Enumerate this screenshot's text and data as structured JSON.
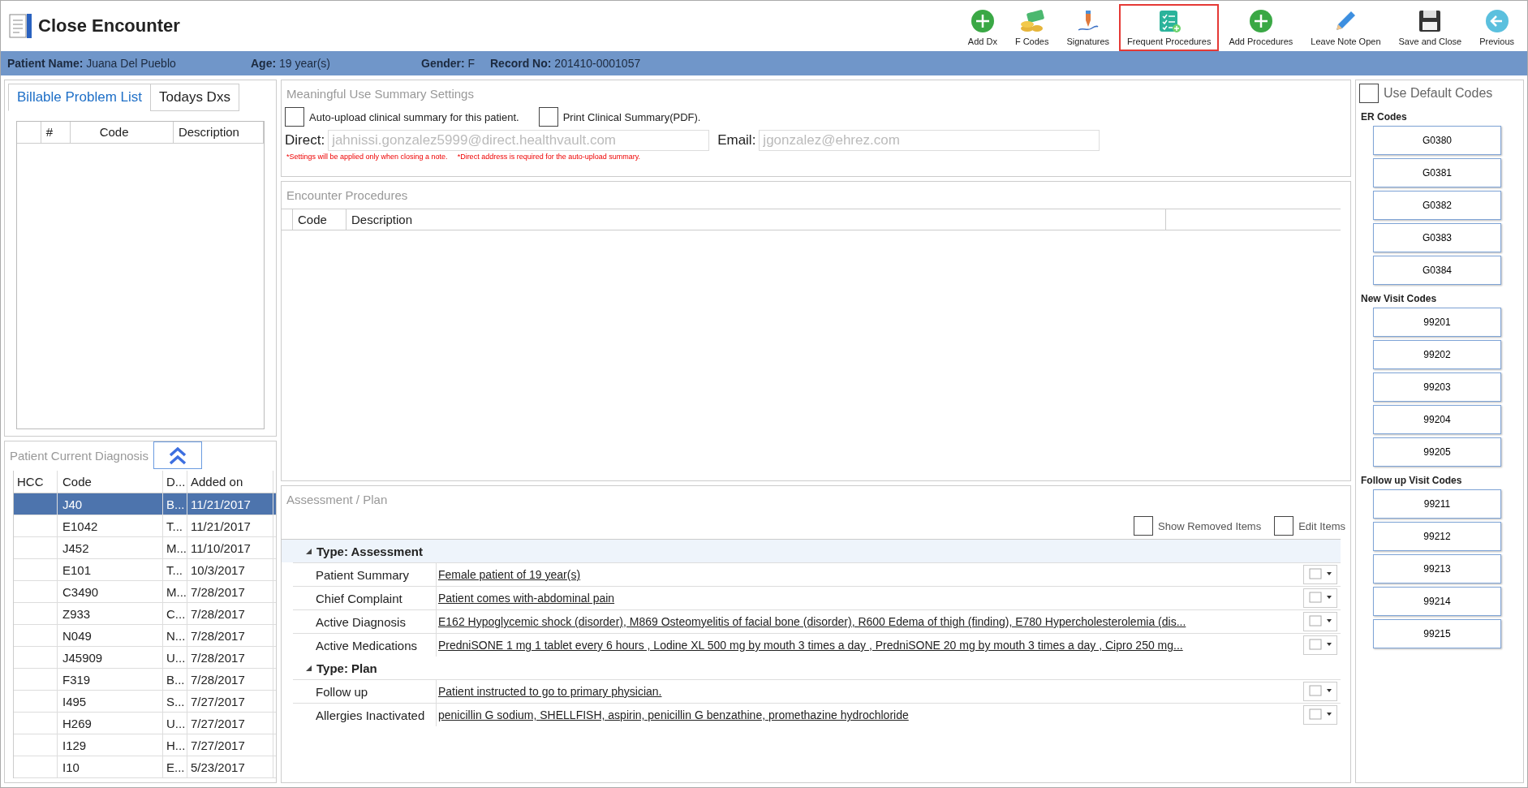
{
  "window": {
    "title": "Close Encounter"
  },
  "toolbar": [
    {
      "label": "Add Dx",
      "selected": false
    },
    {
      "label": "F Codes",
      "selected": false
    },
    {
      "label": "Signatures",
      "selected": false
    },
    {
      "label": "Frequent Procedures",
      "selected": true
    },
    {
      "label": "Add Procedures",
      "selected": false
    },
    {
      "label": "Leave Note Open",
      "selected": false
    },
    {
      "label": "Save and Close",
      "selected": false
    },
    {
      "label": "Previous",
      "selected": false
    }
  ],
  "patient_bar": [
    {
      "label": "Patient Name:",
      "value": "Juana Del Pueblo"
    },
    {
      "label": "Age:",
      "value": "19 year(s)"
    },
    {
      "label": "Gender:",
      "value": "F"
    },
    {
      "label": "Record No:",
      "value": "201410-0001057"
    }
  ],
  "tabs": [
    {
      "label": "Billable Problem List",
      "selected": true
    },
    {
      "label": "Todays Dxs",
      "selected": false
    }
  ],
  "problem_list": {
    "columns": [
      "#",
      "Code",
      "Description"
    ]
  },
  "current_diagnosis": {
    "title": "Patient Current Diagnosis",
    "columns": [
      "HCC",
      "Code",
      "D...",
      "Added on"
    ],
    "rows": [
      {
        "code": "J40",
        "d": "B...",
        "added_on": "11/21/2017",
        "selected": true
      },
      {
        "code": "E1042",
        "d": "T...",
        "added_on": "11/21/2017",
        "selected": false
      },
      {
        "code": "J452",
        "d": "M...",
        "added_on": "11/10/2017",
        "selected": false
      },
      {
        "code": "E101",
        "d": "T...",
        "added_on": "10/3/2017",
        "selected": false
      },
      {
        "code": "C3490",
        "d": "M...",
        "added_on": "7/28/2017",
        "selected": false
      },
      {
        "code": "Z933",
        "d": "C...",
        "added_on": "7/28/2017",
        "selected": false
      },
      {
        "code": "N049",
        "d": "N...",
        "added_on": "7/28/2017",
        "selected": false
      },
      {
        "code": "J45909",
        "d": "U...",
        "added_on": "7/28/2017",
        "selected": false
      },
      {
        "code": "F319",
        "d": "B...",
        "added_on": "7/28/2017",
        "selected": false
      },
      {
        "code": "I495",
        "d": "S...",
        "added_on": "7/27/2017",
        "selected": false
      },
      {
        "code": "H269",
        "d": "U...",
        "added_on": "7/27/2017",
        "selected": false
      },
      {
        "code": "I129",
        "d": "H...",
        "added_on": "7/27/2017",
        "selected": false
      },
      {
        "code": "I10",
        "d": "E...",
        "added_on": "5/23/2017",
        "selected": false
      }
    ]
  },
  "meaningful_use": {
    "title": "Meaningful Use Summary Settings",
    "checkboxes": [
      {
        "label": "Auto-upload clinical summary for this patient.",
        "checked": false
      },
      {
        "label": "Print Clinical Summary(PDF).",
        "checked": false
      }
    ],
    "direct": {
      "label": "Direct:",
      "placeholder": "jahnissi.gonzalez5999@direct.healthvault.com"
    },
    "email": {
      "label": "Email:",
      "placeholder": "jgonzalez@ehrez.com"
    },
    "notes": [
      "*Settings will be applied only when closing a note.",
      "*Direct address is required for the auto-upload summary."
    ]
  },
  "encounter_procedures": {
    "title": "Encounter Procedures",
    "columns": [
      "Code",
      "Description"
    ]
  },
  "assessment_plan": {
    "title": "Assessment / Plan",
    "options": [
      {
        "label": "Show Removed Items",
        "checked": false
      },
      {
        "label": "Edit Items",
        "checked": false
      }
    ],
    "groups": [
      {
        "type": "Type: Assessment",
        "expanded": true,
        "rows": [
          {
            "label": "Patient Summary",
            "value": "Female patient of 19 year(s)"
          },
          {
            "label": "Chief Complaint",
            "value": "Patient comes with-abdominal pain"
          },
          {
            "label": "Active Diagnosis",
            "value": "E162 Hypoglycemic shock (disorder), M869 Osteomyelitis of facial bone (disorder), R600 Edema of thigh (finding), E780 Hypercholesterolemia (dis..."
          },
          {
            "label": "Active Medications",
            "value": "PredniSONE 1 mg 1 tablet every 6 hours , Lodine XL 500 mg by mouth 3 times a day , PredniSONE 20 mg by mouth 3 times a day , Cipro 250 mg..."
          }
        ]
      },
      {
        "type": "Type: Plan",
        "expanded": true,
        "rows": [
          {
            "label": "Follow up",
            "value": "Patient instructed to go to primary physician."
          },
          {
            "label": "Allergies Inactivated",
            "value": "penicillin G sodium, SHELLFISH, aspirin, penicillin G benzathine, promethazine hydrochloride"
          }
        ]
      }
    ]
  },
  "codes": {
    "use_default": {
      "label": "Use Default Codes",
      "checked": false
    },
    "sections": [
      {
        "title": "ER Codes",
        "codes": [
          "G0380",
          "G0381",
          "G0382",
          "G0383",
          "G0384"
        ]
      },
      {
        "title": "New Visit Codes",
        "codes": [
          "99201",
          "99202",
          "99203",
          "99204",
          "99205"
        ]
      },
      {
        "title": "Follow up Visit Codes",
        "codes": [
          "99211",
          "99212",
          "99213",
          "99214",
          "99215"
        ]
      }
    ]
  }
}
